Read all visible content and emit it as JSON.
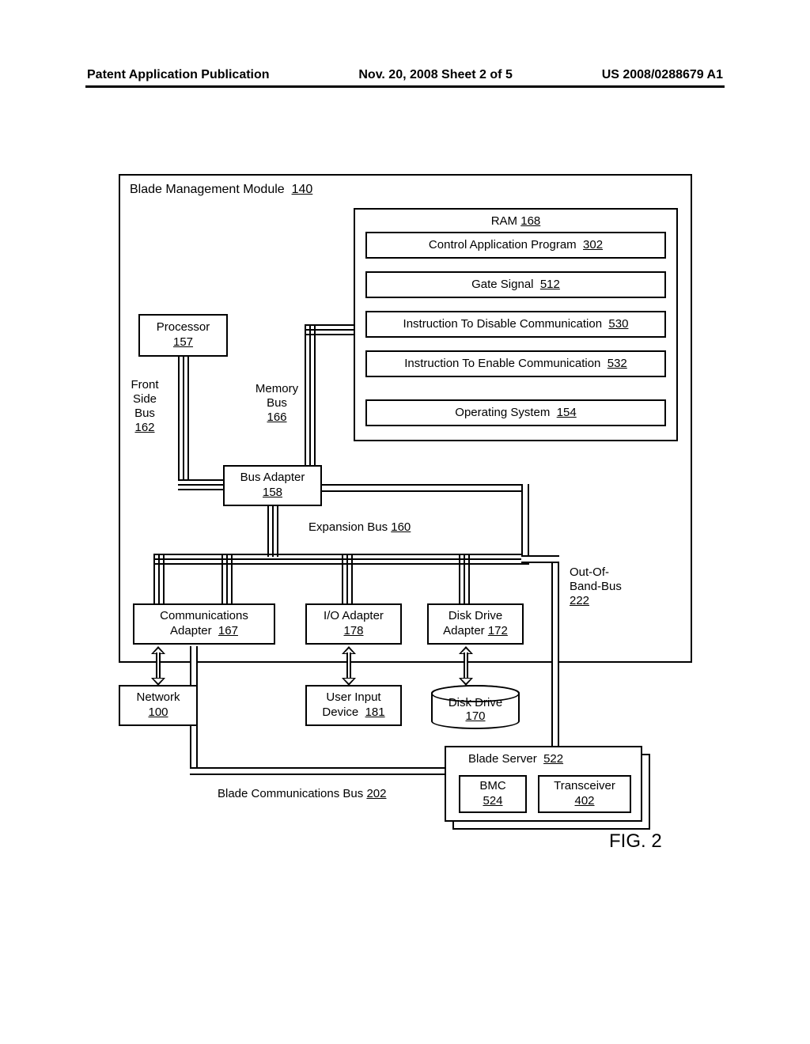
{
  "header": {
    "left": "Patent Application Publication",
    "center": "Nov. 20, 2008  Sheet 2 of 5",
    "right": "US 2008/0288679 A1"
  },
  "module": {
    "title_prefix": "Blade Management Module",
    "ref": "140"
  },
  "processor": {
    "label": "Processor",
    "ref": "157"
  },
  "ram": {
    "label": "RAM",
    "ref": "168"
  },
  "ram_items": {
    "cap": {
      "label": "Control Application Program",
      "ref": "302"
    },
    "gate": {
      "label": "Gate Signal",
      "ref": "512"
    },
    "dis": {
      "label": "Instruction To Disable Communication",
      "ref": "530"
    },
    "en": {
      "label": "Instruction To Enable Communication",
      "ref": "532"
    },
    "os": {
      "label": "Operating System",
      "ref": "154"
    }
  },
  "bus_labels": {
    "fsb": {
      "label": "Front\nSide\nBus",
      "ref": "162"
    },
    "membus": {
      "label": "Memory\nBus",
      "ref": "166"
    },
    "expbus": {
      "label": "Expansion Bus",
      "ref": "160"
    },
    "oob": {
      "label": "Out-Of-\nBand-Bus",
      "ref": "222"
    },
    "bcb": {
      "label": "Blade Communications Bus",
      "ref": "202"
    }
  },
  "bus_adapter": {
    "label": "Bus Adapter",
    "ref": "158"
  },
  "comm_adapter": {
    "label": "Communications\nAdapter",
    "ref": "167"
  },
  "io_adapter": {
    "label": "I/O Adapter",
    "ref": "178"
  },
  "dd_adapter": {
    "label": "Disk Drive\nAdapter",
    "ref": "172"
  },
  "network": {
    "label": "Network",
    "ref": "100"
  },
  "uid": {
    "label": "User Input\nDevice",
    "ref": "181"
  },
  "disk": {
    "label": "Disk Drive",
    "ref": "170"
  },
  "blade_server": {
    "label": "Blade Server",
    "ref": "522"
  },
  "bmc": {
    "label": "BMC",
    "ref": "524"
  },
  "transceiver": {
    "label": "Transceiver",
    "ref": "402"
  },
  "fig": "FIG. 2"
}
